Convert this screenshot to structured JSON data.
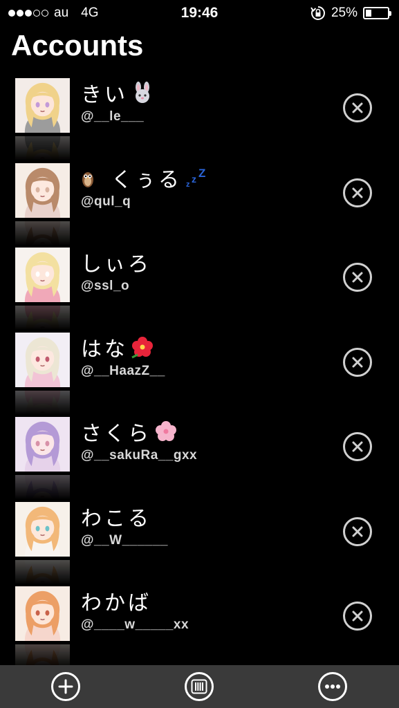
{
  "status_bar": {
    "carrier": "au",
    "network": "4G",
    "time": "19:46",
    "battery": "25%",
    "battery_level": 0.25
  },
  "page_title": "Accounts",
  "accounts": [
    {
      "name": "きい",
      "handle": "@__le___",
      "emoji": "rabbit-emoji",
      "art": {
        "bg": "#f3ece8",
        "hair": "#f0d28a",
        "skin": "#fde6da",
        "cloth": "#9c9c9c",
        "accent": "#c49ad8"
      }
    },
    {
      "name": "くぅる",
      "handle": "@qul_q",
      "emoji": "owl-zzz-emoji",
      "art": {
        "bg": "#f6ede6",
        "hair": "#b98a6a",
        "skin": "#fde9df",
        "cloth": "#e9d2cc",
        "accent": "#d9b3a0"
      }
    },
    {
      "name": "しぃろ",
      "handle": "@ssl_o",
      "emoji": "",
      "art": {
        "bg": "#f7f2ee",
        "hair": "#f3e0a0",
        "skin": "#fde7dc",
        "cloth": "#f0a8b8",
        "accent": "#ffffff"
      }
    },
    {
      "name": "はな",
      "handle": "@__HaazZ__",
      "emoji": "hibiscus-emoji",
      "art": {
        "bg": "#f2eef5",
        "hair": "#ece6d4",
        "skin": "#fde8e0",
        "cloth": "#f2c4d6",
        "accent": "#c05a6e"
      }
    },
    {
      "name": "さくら",
      "handle": "@__sakuRa__gxx",
      "emoji": "cherry-blossom-emoji",
      "art": {
        "bg": "#efe4f2",
        "hair": "#b49ad6",
        "skin": "#fbe6e8",
        "cloth": "#e6d2ea",
        "accent": "#d891a8"
      }
    },
    {
      "name": "わこる",
      "handle": "@__W______",
      "emoji": "",
      "art": {
        "bg": "#f7f1ea",
        "hair": "#f2b879",
        "skin": "#fde8dc",
        "cloth": "#f8f4f0",
        "accent": "#6ec2c8"
      }
    },
    {
      "name": "わかば",
      "handle": "@____w_____xx",
      "emoji": "",
      "art": {
        "bg": "#f7ece4",
        "hair": "#ec9f66",
        "skin": "#fde6d8",
        "cloth": "#f6d6cc",
        "accent": "#c9624a"
      }
    }
  ],
  "tab_bar": [
    "plus-icon",
    "columns-icon",
    "more-icon"
  ],
  "colors": {
    "background": "#000000",
    "tab_bar": "#3a3a3a",
    "remove_ring": "#d0d0d0"
  }
}
